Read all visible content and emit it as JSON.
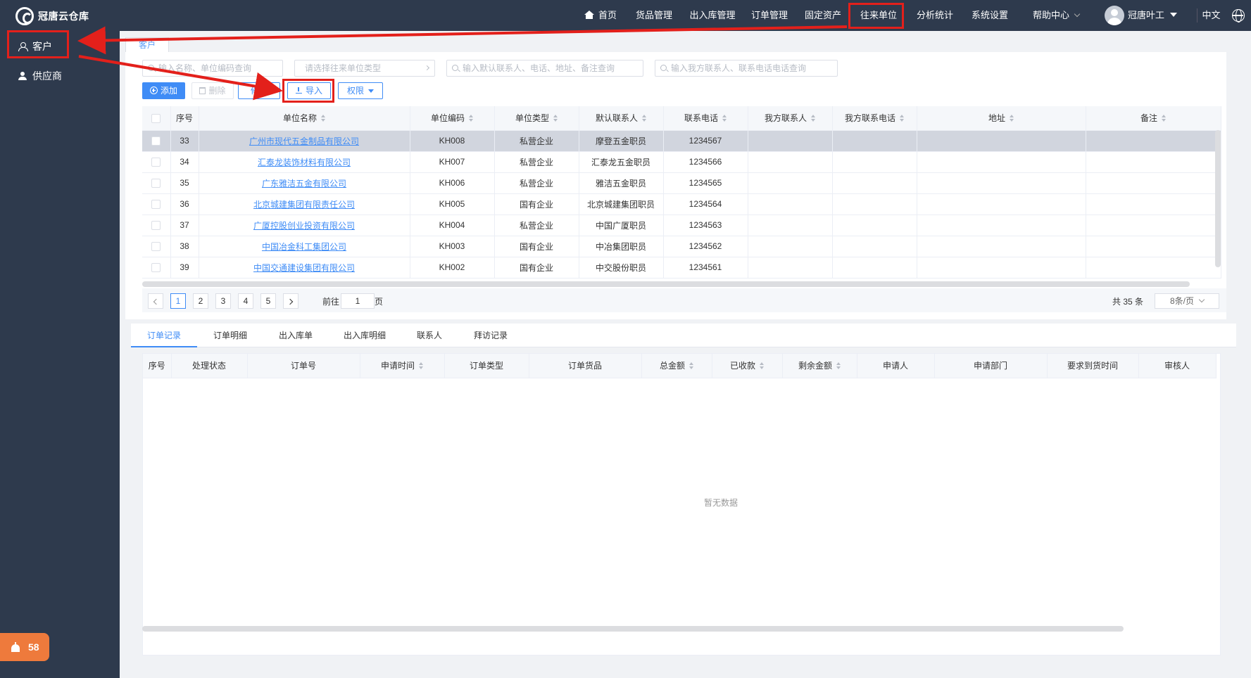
{
  "app": {
    "title": "冠唐云仓库"
  },
  "sidebar": {
    "items": [
      {
        "label": "客户"
      },
      {
        "label": "供应商"
      }
    ],
    "notification_count": "58"
  },
  "topnav": {
    "items": [
      "首页",
      "货品管理",
      "出入库管理",
      "订单管理",
      "固定资产",
      "往来单位",
      "分析统计",
      "系统设置",
      "帮助中心"
    ],
    "active": "往来单位",
    "user": "冠唐叶工",
    "language": "中文"
  },
  "page_tab": "客户",
  "filters": {
    "name_placeholder": "输入名称、单位编码查询",
    "type_placeholder": "请选择往来单位类型",
    "contact_placeholder": "输入默认联系人、电话、地址、备注查询",
    "our_contact_placeholder": "输入我方联系人、联系电话电话查询"
  },
  "toolbar": {
    "add": "添加",
    "delete": "删除",
    "edit": "修改",
    "import": "导入",
    "permission": "权限"
  },
  "table": {
    "columns": [
      "序号",
      "单位名称",
      "单位编码",
      "单位类型",
      "默认联系人",
      "联系电话",
      "我方联系人",
      "我方联系电话",
      "地址",
      "备注"
    ],
    "rows": [
      {
        "no": "33",
        "name": "广州市现代五金制品有限公司",
        "code": "KH008",
        "type": "私营企业",
        "contact": "摩登五金职员",
        "phone": "1234567"
      },
      {
        "no": "34",
        "name": "汇泰龙装饰材料有限公司",
        "code": "KH007",
        "type": "私营企业",
        "contact": "汇泰龙五金职员",
        "phone": "1234566"
      },
      {
        "no": "35",
        "name": "广东雅洁五金有限公司",
        "code": "KH006",
        "type": "私营企业",
        "contact": "雅洁五金职员",
        "phone": "1234565"
      },
      {
        "no": "36",
        "name": "北京城建集团有限责任公司",
        "code": "KH005",
        "type": "国有企业",
        "contact": "北京城建集团职员",
        "phone": "1234564"
      },
      {
        "no": "37",
        "name": "广厦控股创业投资有限公司",
        "code": "KH004",
        "type": "私营企业",
        "contact": "中国广厦职员",
        "phone": "1234563"
      },
      {
        "no": "38",
        "name": "中国冶金科工集团公司",
        "code": "KH003",
        "type": "国有企业",
        "contact": "中冶集团职员",
        "phone": "1234562"
      },
      {
        "no": "39",
        "name": "中国交通建设集团有限公司",
        "code": "KH002",
        "type": "国有企业",
        "contact": "中交股份职员",
        "phone": "1234561"
      }
    ]
  },
  "pager": {
    "pages": [
      "1",
      "2",
      "3",
      "4",
      "5"
    ],
    "goto_prefix": "前往",
    "goto_value": "1",
    "goto_suffix": "页",
    "total": "共 35 条",
    "page_size": "8条/页"
  },
  "subtabs": [
    "订单记录",
    "订单明细",
    "出入库单",
    "出入库明细",
    "联系人",
    "拜访记录"
  ],
  "orders": {
    "columns": [
      "序号",
      "处理状态",
      "订单号",
      "申请时间",
      "订单类型",
      "订单货品",
      "总金额",
      "已收款",
      "剩余金额",
      "申请人",
      "申请部门",
      "要求到货时间",
      "审核人"
    ],
    "empty_text": "暂无数据"
  },
  "colors": {
    "sidebar_bg": "#2e3a4d",
    "accent": "#3f8cf6",
    "annotation": "#e3201b",
    "notif": "#ee7a3c"
  }
}
